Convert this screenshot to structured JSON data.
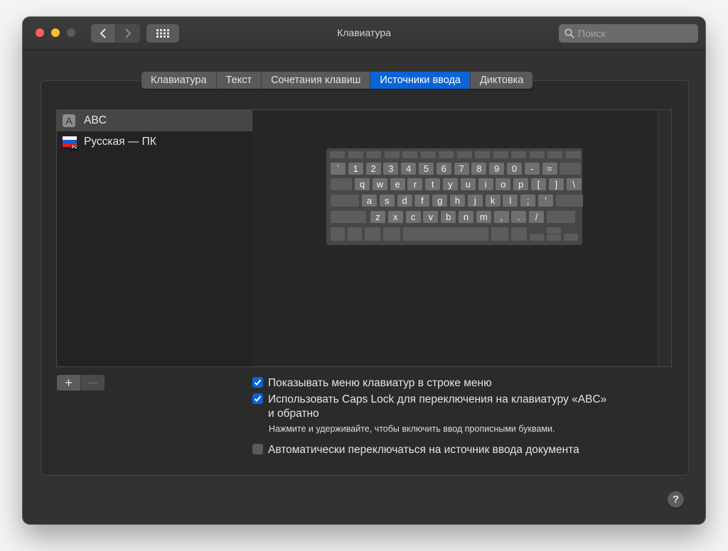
{
  "window": {
    "title": "Клавиатура",
    "search_placeholder": "Поиск"
  },
  "tabs": [
    {
      "label": "Клавиатура",
      "active": false
    },
    {
      "label": "Текст",
      "active": false
    },
    {
      "label": "Сочетания клавиш",
      "active": false
    },
    {
      "label": "Источники ввода",
      "active": true
    },
    {
      "label": "Диктовка",
      "active": false
    }
  ],
  "input_sources": [
    {
      "icon": "letter-a-icon",
      "icon_text": "A",
      "label": "ABC",
      "selected": true
    },
    {
      "icon": "russian-flag-icon",
      "icon_text": "PC",
      "label": "Русская — ПК",
      "selected": false
    }
  ],
  "keyboard_preview": {
    "row1": [
      "`",
      "1",
      "2",
      "3",
      "4",
      "5",
      "6",
      "7",
      "8",
      "9",
      "0",
      "-",
      "="
    ],
    "row2": [
      "q",
      "w",
      "e",
      "r",
      "t",
      "y",
      "u",
      "i",
      "o",
      "p",
      "[",
      "]",
      "\\"
    ],
    "row3": [
      "a",
      "s",
      "d",
      "f",
      "g",
      "h",
      "j",
      "k",
      "l",
      ";",
      "'"
    ],
    "row4": [
      "z",
      "x",
      "c",
      "v",
      "b",
      "n",
      "m",
      ",",
      ".",
      "/"
    ]
  },
  "buttons": {
    "add": "+",
    "remove": "—"
  },
  "options": {
    "show_menu": {
      "label": "Показывать меню клавиатур в строке меню",
      "checked": true
    },
    "caps_lock": {
      "label_line1": "Использовать Caps Lock для переключения на клавиатуру «ABC»",
      "label_line2": "и обратно",
      "checked": true
    },
    "caps_hint": "Нажмите и удерживайте, чтобы включить ввод прописными буквами.",
    "auto_switch": {
      "label": "Автоматически переключаться на источник ввода документа",
      "checked": false
    }
  },
  "help_label": "?",
  "colors": {
    "accent": "#0a64d7",
    "window_bg": "#323232"
  }
}
